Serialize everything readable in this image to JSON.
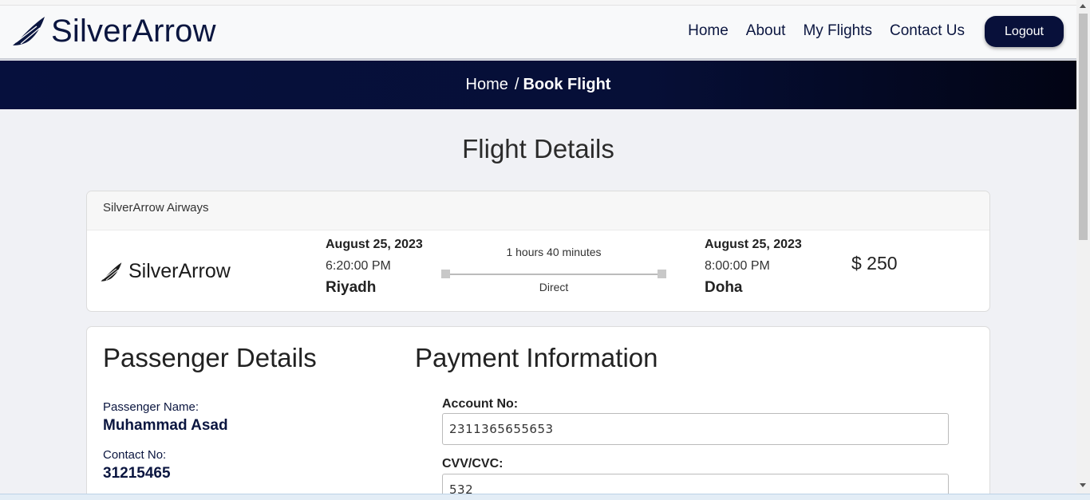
{
  "navbar": {
    "brand": "SilverArrow",
    "links": [
      "Home",
      "About",
      "My Flights",
      "Contact Us"
    ],
    "logout_label": "Logout"
  },
  "breadcrumb": {
    "home": "Home",
    "separator": "/",
    "current": "Book Flight"
  },
  "page_title": "Flight Details",
  "flight": {
    "airline": "SilverArrow Airways",
    "logo_text": "SilverArrow",
    "departure": {
      "date": "August 25, 2023",
      "time": "6:20:00 PM",
      "city": "Riyadh"
    },
    "duration": "1 hours 40 minutes",
    "stops": "Direct",
    "arrival": {
      "date": "August 25, 2023",
      "time": "8:00:00 PM",
      "city": "Doha"
    },
    "price": "$ 250"
  },
  "passenger": {
    "heading": "Passenger Details",
    "name_label": "Passenger Name:",
    "name_value": "Muhammad Asad",
    "contact_label": "Contact No:",
    "contact_value": "31215465"
  },
  "payment": {
    "heading": "Payment Information",
    "account_label": "Account No:",
    "account_value": "2311365655653",
    "cvv_label": "CVV/CVC:",
    "cvv_value": "532"
  },
  "colors": {
    "navy": "#08103a",
    "brand_text": "#0b1640"
  }
}
